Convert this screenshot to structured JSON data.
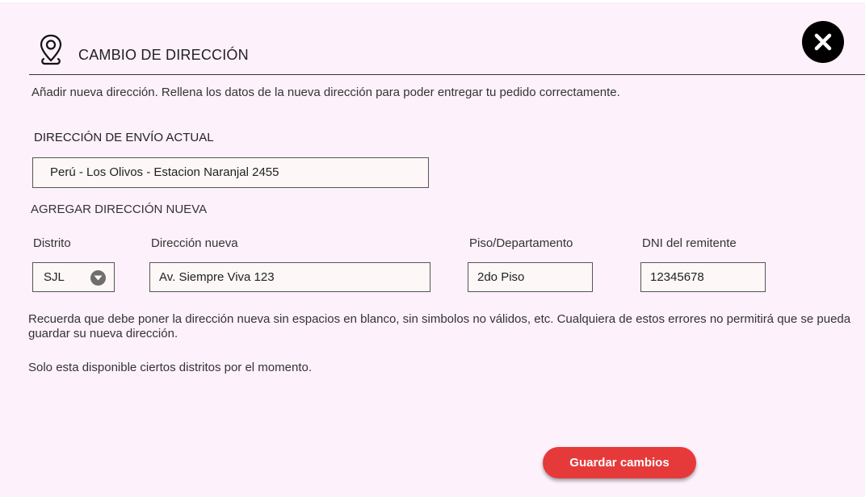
{
  "header": {
    "title": "CAMBIO DE DIRECCIÓN",
    "icon": "map-pin-icon",
    "close_icon": "close-icon"
  },
  "intro": {
    "text": "Añadir nueva dirección. Rellena los datos de la nueva dirección para poder entregar tu pedido correctamente."
  },
  "current_address": {
    "label": "DIRECCIÓN DE ENVÍO ACTUAL",
    "value": "Perú - Los Olivos - Estacion Naranjal 2455"
  },
  "new_address": {
    "label": "AGREGAR DIRECCIÓN NUEVA",
    "district": {
      "label": "Distrito",
      "value": "SJL"
    },
    "address": {
      "label": "Dirección nueva",
      "value": "Av. Siempre Viva 123"
    },
    "floor": {
      "label": "Piso/Departamento",
      "value": "2do Piso"
    },
    "dni": {
      "label": "DNI del remitente",
      "value": "12345678"
    }
  },
  "notes": {
    "warning": "Recuerda que debe poner la dirección nueva sin espacios en blanco, sin simbolos no válidos, etc. Cualquiera de estos errores no permitirá que se pueda guardar su nueva dirección.",
    "districts": "Solo esta disponible ciertos distritos por el momento."
  },
  "actions": {
    "save_label": "Guardar cambios"
  },
  "colors": {
    "panel_background": "#fdf1fb",
    "primary_button": "#e63a3a",
    "close_button": "#000000"
  }
}
